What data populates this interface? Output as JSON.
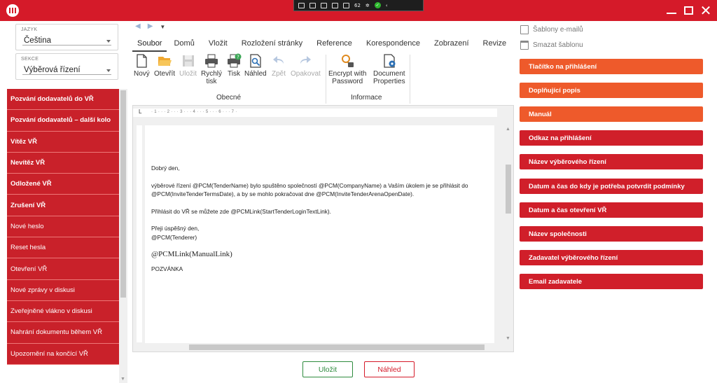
{
  "window": {
    "taskbar_icons": [
      "screen-icon",
      "camera-icon",
      "pointer-icon",
      "frame-icon",
      "tree-icon"
    ],
    "taskbar_value": "62",
    "colors": {
      "titlebar": "#d51a29",
      "primary": "#c9212a",
      "accent_orange": "#ee5a2b",
      "save_green": "#2e8b3e"
    }
  },
  "left": {
    "language_label": "JAZYK",
    "language_value": "Čeština",
    "section_label": "SEKCE",
    "section_value": "Výběrová řízení",
    "templates": [
      {
        "label": "Pozvání dodavatelů do VŘ",
        "bold": true
      },
      {
        "label": "Pozvání dodavatelů – další kolo",
        "bold": true
      },
      {
        "label": "Vítěz VŘ",
        "bold": true
      },
      {
        "label": "Nevítěz VŘ",
        "bold": true
      },
      {
        "label": "Odložené VŘ",
        "bold": true
      },
      {
        "label": "Zrušení VŘ",
        "bold": true
      },
      {
        "label": "Nové heslo",
        "bold": false
      },
      {
        "label": "Reset hesla",
        "bold": false
      },
      {
        "label": "Otevření VŘ",
        "bold": false
      },
      {
        "label": "Nové zprávy v diskusi",
        "bold": false
      },
      {
        "label": "Zveřejněné vlákno v diskusi",
        "bold": false
      },
      {
        "label": "Nahrání dokumentu během VŘ",
        "bold": false
      },
      {
        "label": "Upozornění na končící VŘ",
        "bold": false
      }
    ]
  },
  "ribbon": {
    "tabs": [
      "Soubor",
      "Domů",
      "Vložit",
      "Rozložení stránky",
      "Reference",
      "Korespondence",
      "Zobrazení",
      "Revize"
    ],
    "group_general": "Obecné",
    "group_info": "Informace",
    "buttons": {
      "new": "Nový",
      "open": "Otevřít",
      "save": "Uložit",
      "quick_print_1": "Rychlý",
      "quick_print_2": "tisk",
      "print": "Tisk",
      "preview": "Náhled",
      "back": "Zpět",
      "redo": "Opakovat",
      "encrypt_1": "Encrypt with",
      "encrypt_2": "Password",
      "docprops_1": "Document",
      "docprops_2": "Properties"
    }
  },
  "document": {
    "greeting": "Dobrý den,",
    "body_1": "výběrové řízení @PCM(TenderName) bylo spuštěno společností @PCM(CompanyName) a Vaším úkolem je se přihlásit do @PCM(InviteTenderTermsDate), a by se mohlo pokračovat dne @PCM(InviteTenderArenaOpenDate).",
    "body_2": "Přihlásit do VŘ se můžete zde @PCMLink(StartTenderLoginTextLink).",
    "closing_1": "Přeji úspěšný den,",
    "closing_2": "@PCM(Tenderer)",
    "manual_link": "@PCMLink(ManualLink)",
    "footer": "POZVÁNKA",
    "ruler": "· 1 · · · 2 · · · 3 · · · 4 · · · 5 · · · 6 · · · 7 ·"
  },
  "right": {
    "email_templates": "Šablony e-mailů",
    "delete_template": "Smazat šablonu",
    "tokens": [
      {
        "label": "Tlačítko na přihlášení",
        "style": "orange"
      },
      {
        "label": "Doplňující popis",
        "style": "orange"
      },
      {
        "label": "Manuál",
        "style": "orange"
      },
      {
        "label": "Odkaz na přihlášení",
        "style": "red"
      },
      {
        "label": "Název výběrového řízení",
        "style": "red"
      },
      {
        "label": "Datum a čas do kdy je potřeba potvrdit podmínky",
        "style": "red"
      },
      {
        "label": "Datum a čas otevření VŘ",
        "style": "red"
      },
      {
        "label": "Název společnosti",
        "style": "red"
      },
      {
        "label": "Zadavatel výběrového řízení",
        "style": "red"
      },
      {
        "label": "Email zadavatele",
        "style": "red"
      }
    ]
  },
  "footer": {
    "save": "Uložit",
    "preview": "Náhled"
  }
}
